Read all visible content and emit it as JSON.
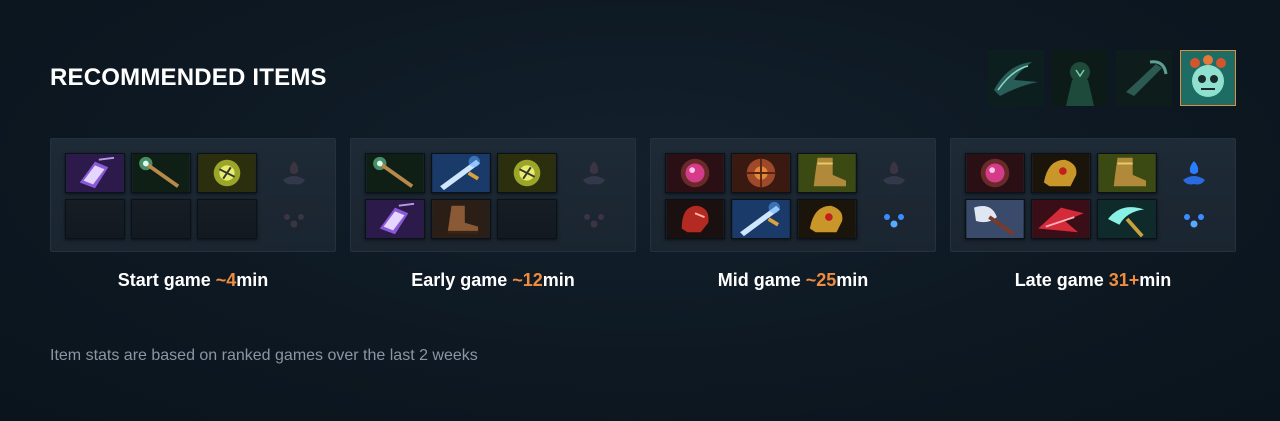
{
  "header": {
    "title": "RECOMMENDED ITEMS"
  },
  "abilities": [
    {
      "icon": "ability-1-icon",
      "active": false
    },
    {
      "icon": "ability-2-icon",
      "active": false
    },
    {
      "icon": "ability-3-icon",
      "active": false
    },
    {
      "icon": "ability-4-icon",
      "active": true
    }
  ],
  "phases": [
    {
      "label": "Start game ",
      "time": "~4",
      "unit": "min",
      "items": [
        "tango-icon",
        "wand-icon",
        "faerie-icon",
        "empty",
        "empty",
        "empty"
      ],
      "neutral_tokens": [
        "inactive",
        "inactive"
      ]
    },
    {
      "label": "Early game ",
      "time": "~12",
      "unit": "min",
      "items": [
        "wand-icon",
        "blade-icon",
        "faerie-icon",
        "tango-icon",
        "boots-icon",
        "empty"
      ],
      "neutral_tokens": [
        "inactive",
        "inactive"
      ]
    },
    {
      "label": "Mid game ",
      "time": "~25",
      "unit": "min",
      "items": [
        "orb-icon",
        "shield-icon",
        "greaves-icon",
        "helm-icon",
        "blade-icon",
        "gold-helm-icon"
      ],
      "neutral_tokens": [
        "inactive",
        "active"
      ]
    },
    {
      "label": "Late game ",
      "time": "31+",
      "unit": "min",
      "items": [
        "orb-icon",
        "gold-helm-icon",
        "greaves-icon",
        "axe-icon",
        "dragon-icon",
        "scythe-icon"
      ],
      "neutral_tokens": [
        "active",
        "active"
      ]
    }
  ],
  "footnote": "Item stats are based on ranked games over the last 2 weeks",
  "colors": {
    "accent": "#f08c3e",
    "background": "#0d1822",
    "panel": "#1d2833",
    "muted": "#8b96a3"
  }
}
